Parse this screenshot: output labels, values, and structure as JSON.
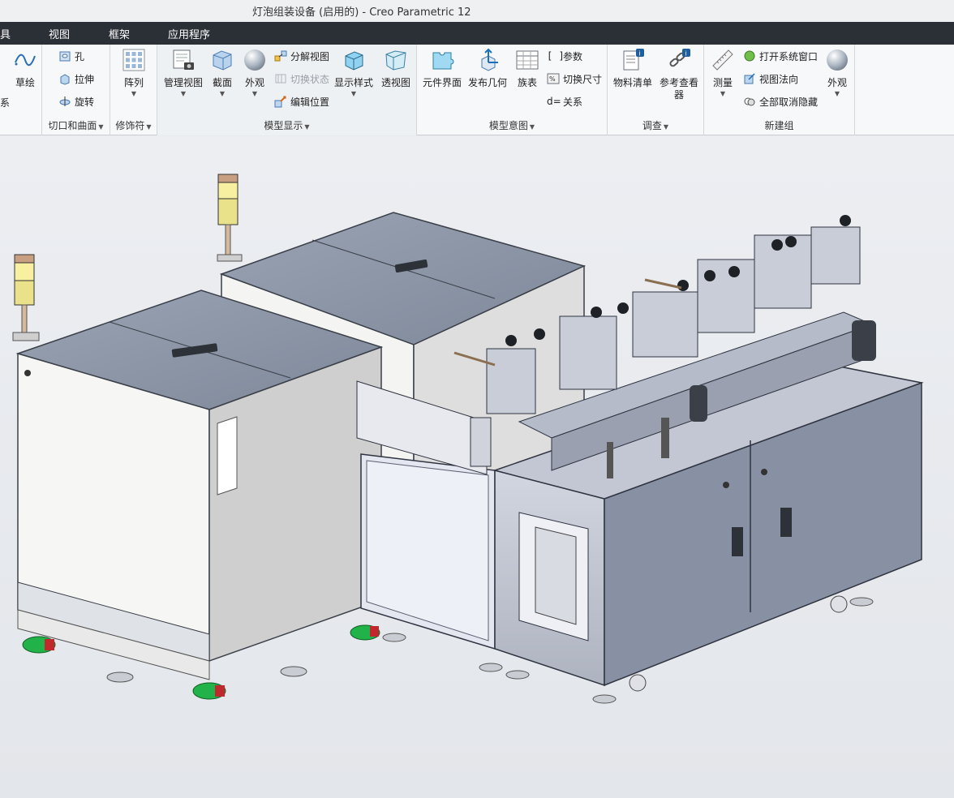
{
  "window": {
    "title": "灯泡组装设备 (启用的) - Creo Parametric 12"
  },
  "menu": {
    "items": [
      "具",
      "视图",
      "框架",
      "应用程序"
    ]
  },
  "ribbon": {
    "groups": {
      "sketch": {
        "label": "系"
      },
      "cut_surface": {
        "label": "切口和曲面"
      },
      "modifier": {
        "label": "修饰符"
      },
      "model_display": {
        "label": "模型显示"
      },
      "model_intent": {
        "label": "模型意图"
      },
      "investigate": {
        "label": "调查"
      },
      "new_group": {
        "label": "新建组"
      }
    },
    "buttons": {
      "sketch": "草绘",
      "hole": "孔",
      "extrude": "拉伸",
      "revolve": "旋转",
      "pattern": "阵列",
      "manage_views": "管理视图",
      "section": "截面",
      "appearance": "外观",
      "explode_view": "分解视图",
      "toggle_status": "切换状态",
      "edit_position": "编辑位置",
      "display_style": "显示样式",
      "perspective": "透视图",
      "component_interface": "元件界面",
      "publish_geometry": "发布几何",
      "family_table": "族表",
      "parameters": "参数",
      "switch_dimensions": "切换尺寸",
      "relations": "关系",
      "bill_of_materials": "物料清单",
      "reference_viewer_1": "参考查看",
      "reference_viewer_2": "器",
      "measure": "测量",
      "open_system_window": "打开系统窗口",
      "view_normal": "视图法向",
      "unhide_all": "全部取消隐藏",
      "appearance_2": "外观"
    }
  },
  "colors": {
    "menubar": "#2b2f36",
    "ribbon": "#f7f8fa",
    "viewport": "#e6e8ec",
    "cabinet_white": "#f1f1ef",
    "panel_slate": "#8e97a8",
    "machine_frame": "#c7cbd6",
    "caster_green": "#22b24a"
  }
}
